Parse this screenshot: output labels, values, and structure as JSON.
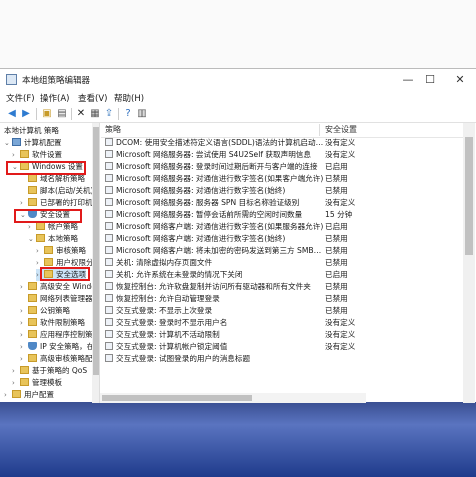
{
  "window": {
    "title": "本地组策略编辑器",
    "controls": {
      "minimize": "—",
      "maximize": "☐",
      "close": "✕"
    }
  },
  "menu": [
    "文件(F)",
    "操作(A)",
    "查看(V)",
    "帮助(H)"
  ],
  "toolbar": [
    "back-icon",
    "forward-icon",
    "folder-up-icon",
    "show-tree-icon",
    "delete-icon",
    "properties-icon",
    "export-icon",
    "help-icon",
    "console-icon"
  ],
  "tree": [
    {
      "label": "本地计算机 策略",
      "icon": "computer"
    },
    {
      "label": "计算机配置",
      "icon": "computer"
    },
    {
      "label": "软件设置",
      "icon": "folder"
    },
    {
      "label": "Windows 设置",
      "icon": "folder"
    },
    {
      "label": "域名解析策略",
      "icon": "folder"
    },
    {
      "label": "脚本(启动/关机)",
      "icon": "folder"
    },
    {
      "label": "已部署的打印机",
      "icon": "folder"
    },
    {
      "label": "安全设置",
      "icon": "shield"
    },
    {
      "label": "帐户策略",
      "icon": "folder"
    },
    {
      "label": "本地策略",
      "icon": "folder"
    },
    {
      "label": "审核策略",
      "icon": "folder"
    },
    {
      "label": "用户权限分配",
      "icon": "folder"
    },
    {
      "label": "安全选项",
      "icon": "folder"
    },
    {
      "label": "高级安全 Windows",
      "icon": "folder"
    },
    {
      "label": "网络列表管理器",
      "icon": "folder"
    },
    {
      "label": "公钥策略",
      "icon": "folder"
    },
    {
      "label": "软件限制策略",
      "icon": "folder"
    },
    {
      "label": "应用程序控制策略",
      "icon": "folder"
    },
    {
      "label": "IP 安全策略，在本",
      "icon": "shield"
    },
    {
      "label": "高级审核策略配置",
      "icon": "folder"
    },
    {
      "label": "基于策略的 QoS",
      "icon": "folder"
    },
    {
      "label": "管理模板",
      "icon": "folder"
    },
    {
      "label": "用户配置",
      "icon": "folder"
    }
  ],
  "columns": {
    "policy": "策略",
    "setting": "安全设置"
  },
  "policies": [
    {
      "name": "DCOM: 使用安全描述符定义语言(SDDL)语法的计算机启动…",
      "value": "没有定义"
    },
    {
      "name": "Microsoft 网络服务器: 尝试使用 S4U2Self 获取声明信息",
      "value": "没有定义"
    },
    {
      "name": "Microsoft 网络服务器: 登录时间过期后断开与客户端的连接",
      "value": "已启用"
    },
    {
      "name": "Microsoft 网络服务器: 对通信进行数字签名(如果客户端允许)",
      "value": "已禁用"
    },
    {
      "name": "Microsoft 网络服务器: 对通信进行数字签名(始终)",
      "value": "已禁用"
    },
    {
      "name": "Microsoft 网络服务器: 服务器 SPN 目标名称验证级别",
      "value": "没有定义"
    },
    {
      "name": "Microsoft 网络服务器: 暂停会话前所需的空闲时间数量",
      "value": "15 分钟"
    },
    {
      "name": "Microsoft 网络客户端: 对通信进行数字签名(如果服务器允许)",
      "value": "已启用"
    },
    {
      "name": "Microsoft 网络客户端: 对通信进行数字签名(始终)",
      "value": "已禁用"
    },
    {
      "name": "Microsoft 网络客户端: 将未加密的密码发送到第三方 SMB…",
      "value": "已禁用"
    },
    {
      "name": "关机: 清除虚拟内存页面文件",
      "value": "已禁用"
    },
    {
      "name": "关机: 允许系统在未登录的情况下关闭",
      "value": "已启用"
    },
    {
      "name": "恢复控制台: 允许软盘复制并访问所有驱动器和所有文件夹",
      "value": "已禁用"
    },
    {
      "name": "恢复控制台: 允许自动管理登录",
      "value": "已禁用"
    },
    {
      "name": "交互式登录: 不显示上次登录",
      "value": "已禁用"
    },
    {
      "name": "交互式登录: 登录时不显示用户名",
      "value": "没有定义"
    },
    {
      "name": "交互式登录: 计算机不活动限制",
      "value": "没有定义"
    },
    {
      "name": "交互式登录: 计算机帐户锁定阈值",
      "value": "没有定义"
    },
    {
      "name": "交互式登录: 试图登录的用户的消息标题",
      "value": ""
    }
  ]
}
